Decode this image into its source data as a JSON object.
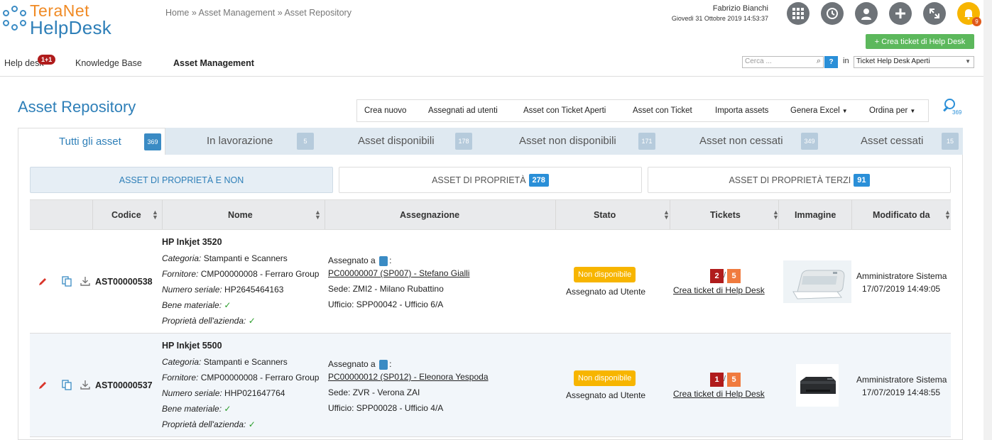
{
  "header": {
    "logo_line1": "TeraNet",
    "logo_line2": "HelpDesk",
    "breadcrumb": "Home » Asset Management » Asset Repository",
    "user_name": "Fabrizio Bianchi",
    "user_date": "Giovedì 31 Ottobre 2019 14:53:37",
    "bell_count": "9",
    "create_ticket_label": "+ Crea ticket di Help Desk",
    "icons": [
      "grid-icon",
      "history-icon",
      "user-icon",
      "plus-icon",
      "fullscreen-icon",
      "bell-icon"
    ]
  },
  "nav": {
    "items": [
      {
        "label": "Help desk"
      },
      {
        "label": "Knowledge Base"
      },
      {
        "label": "Asset Management"
      }
    ],
    "helpdesk_badge": "1+1"
  },
  "search": {
    "placeholder": "Cerca ...",
    "help_label": "?",
    "in_label": "in",
    "scope": "Ticket Help Desk Aperti"
  },
  "page": {
    "title": "Asset Repository",
    "search_count": "369"
  },
  "toolbar": {
    "crea_nuovo": "Crea nuovo",
    "assegnati": "Assegnati ad utenti",
    "ticket_aperti": "Asset con Ticket Aperti",
    "con_ticket": "Asset con Ticket",
    "importa": "Importa assets",
    "excel": "Genera Excel",
    "ordina": "Ordina per"
  },
  "tabs": [
    {
      "label": "Tutti gli asset",
      "count": "369"
    },
    {
      "label": "In lavorazione",
      "count": "5"
    },
    {
      "label": "Asset disponibili",
      "count": "178"
    },
    {
      "label": "Asset non disponibili",
      "count": "171"
    },
    {
      "label": "Asset non cessati",
      "count": "349"
    },
    {
      "label": "Asset cessati",
      "count": "15"
    }
  ],
  "subtabs": {
    "all": "ASSET DI PROPRIETÀ E NON",
    "own": "ASSET DI PROPRIETÀ",
    "own_count": "278",
    "third": "ASSET DI PROPRIETÀ TERZI",
    "third_count": "91"
  },
  "table": {
    "columns": [
      "Codice",
      "Nome",
      "Assegnazione",
      "Stato",
      "Tickets",
      "Immagine",
      "Modificato da"
    ],
    "labels": {
      "categoria": "Categoria:",
      "fornitore": "Fornitore:",
      "seriale": "Numero seriale:",
      "bene": "Bene materiale:",
      "proprieta": "Proprietà dell'azienda:",
      "assegnato": "Assegnato a",
      "check": "✓",
      "create_link": "Crea ticket di Help Desk",
      "sep": "/"
    },
    "rows": [
      {
        "code": "AST00000538",
        "name": "HP Inkjet 3520",
        "categoria": "Stampanti e Scanners",
        "fornitore": "CMP00000008 - Ferraro Group",
        "seriale": "HP2645464163",
        "pc": "PC00000007 (SP007) - Stefano Gialli",
        "sede": "Sede: ZMI2 - Milano Rubattino",
        "ufficio": "Ufficio: SPP00042 - Ufficio 6/A",
        "stato": "Non disponibile",
        "stato_sub": "Assegnato ad Utente",
        "tk_open": "2",
        "tk_total": "5",
        "mod_name": "Amministratore Sistema",
        "mod_date": "17/07/2019 14:49:05"
      },
      {
        "code": "AST00000537",
        "name": "HP Inkjet 5500",
        "categoria": "Stampanti e Scanners",
        "fornitore": "CMP00000008 - Ferraro Group",
        "seriale": "HHP021647764",
        "pc": "PC00000012 (SP012) - Eleonora Yespoda",
        "sede": "Sede: ZVR - Verona ZAI",
        "ufficio": "Ufficio: SPP00028 - Ufficio 4/A",
        "stato": "Non disponibile",
        "stato_sub": "Assegnato ad Utente",
        "tk_open": "1",
        "tk_total": "5",
        "mod_name": "Amministratore Sistema",
        "mod_date": "17/07/2019 14:48:55"
      }
    ]
  },
  "colors": {
    "brand_blue": "#2e7fb8",
    "brand_orange": "#f08a24",
    "green": "#5cb85c",
    "status_yellow": "#f7b500",
    "ticket_red": "#b01c1c",
    "ticket_orange": "#f07b3f"
  }
}
